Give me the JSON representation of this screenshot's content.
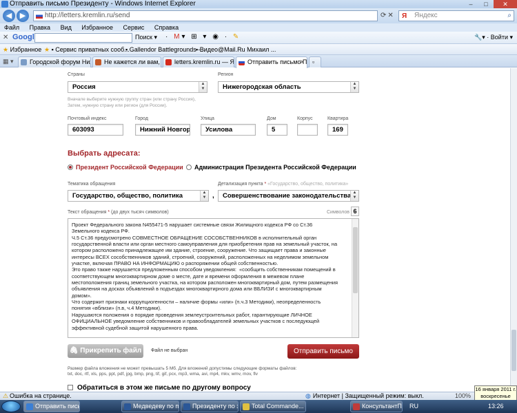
{
  "window": {
    "title": "Отправить письмо Президенту - Windows Internet Explorer",
    "url": "http://letters.kremlin.ru/send",
    "search_placeholder": "Яндекс"
  },
  "menu": [
    "Файл",
    "Правка",
    "Вид",
    "Избранное",
    "Сервис",
    "Справка"
  ],
  "google_toolbar": {
    "logo": "Google",
    "search_label": "Поиск",
    "signin_label": "Войти"
  },
  "favorites": {
    "label": "Избранное",
    "items": [
      "Сервис приватных сооб...",
      "Gallendor Battlegrounds -...",
      "Видео@Mail.Ru Михаил ..."
    ]
  },
  "tabs": [
    {
      "label": "Городской форум Нижне...",
      "active": false
    },
    {
      "label": "Не кажется ли вам, что м...",
      "active": false
    },
    {
      "label": "letters.kremlin.ru — Яндек...",
      "active": false
    },
    {
      "label": "Отправить письмо Пр...",
      "active": true
    }
  ],
  "form": {
    "country_label": "Страны",
    "country_value": "Россия",
    "region_label": "Регион",
    "region_value": "Нижегородская область",
    "country_hint": "Вначале выберите нужную группу стран (или страну Россия),\nЗатем, нужную страну или регион (для России).",
    "postcode_label": "Почтовый индекс",
    "postcode_value": "603093",
    "city_label": "Город",
    "city_value": "Нижний Новгор",
    "street_label": "Улица",
    "street_value": "Усилова",
    "house_label": "Дом",
    "house_value": "5",
    "building_label": "Корпус",
    "building_value": "",
    "flat_label": "Квартира",
    "flat_value": "169",
    "recipient_title": "Выбрать адресата:",
    "recipient_options": [
      {
        "label": "Президент Российской Федерации",
        "selected": true
      },
      {
        "label": "Администрация Президента Российской Федерации",
        "selected": false
      }
    ],
    "topic_label": "Тематика обращения",
    "topic_value": "Государство, общество, политика",
    "detail_label": "Детализация пункта",
    "detail_hint": "«Государство, общество, политика»",
    "detail_value": "Совершенствование законодательства",
    "text_label": "Текст обращения",
    "text_hint": "(до двух тысяч символов)",
    "symbols_label": "Символов",
    "symbols_count": "6",
    "message": "Проект Федерального закона N455471-5 нарушает системные связи Жилищного кодекса РФ со Ст.36\nЗемельного кодекса РФ.\nЧ.5 Ст.36 предусмотрено СОВМЕСТНОЕ ОБРАЩЕНИЕ СОСОБСТВЕННИКОВ в исполнительный орган\nгосударственной власти или орган местного самоуправления для приобретения прав на земельный участок, на\nкотором расположено принадлежащее им здание, строение, сооружение. Что защищает права и законные\nинтересы ВСЕХ сособственников зданий, строений, сооружений, расположенных на неделимом земельном\nучастке, включая ПРАВО НА ИНФОРМАЦИЮ о распоряжении общей собственностью.\nЭто право также нарушается предложенным способом уведомления:  «сообщить собственникам помещений в\nсоответствующем многоквартирном доме о месте, дате и времени оформления в межевом плане\nместоположения границ земельного участка, на котором расположен многоквартирный дом, путем размещения\nобъявления на досках объявлений в подъездах многоквартирного дома или ВБЛИЗИ с многоквартирным\nдомом».\nЧто содержит признаки коррупциогенности – наличие формы «или» (п.ч.3 Методики), неопределенность\nпонятия «вблизи» (п.в, ч.4 Методики).\nНарушаются положения о порядке проведения землеустроительных работ, гарантирующие ЛИЧНОЕ\nОФИЦИАЛЬНОЕ уведомление собственников и правообладателей земельных участков с последующей\nэффективной судебной защитой нарушенного права.",
    "attach_label": "Прикрепить файл",
    "no_file_label": "Файл не выбран",
    "send_label": "Отправить письмо",
    "size_info": "Размер файла вложения не может превышать 5 Мб. Для вложений допустимы следующие форматы файлов:",
    "formats_info": "txt, doc, rtf, xls, pps, ppt, pdf, jpg, bmp, png, tif, gif, pcx, mp3, wma, avi, mp4, mkv, wmv, mov, flv",
    "other_question_label": "Обратиться в этом же письме по другому вопросу"
  },
  "statusbar": {
    "error_text": "Ошибка на странице.",
    "zone_text": "Интернет | Защищенный режим: выкл.",
    "zoom_text": "100%"
  },
  "taskbar": {
    "tasks": [
      "Отправить письм...",
      "Медведеву по пр...",
      "Президенту по з...",
      "Total Commande...",
      "КонсультантПл..."
    ],
    "lang": "RU",
    "time": "13:26"
  },
  "tooltip": {
    "date": "16 января 2011 г.",
    "weekday": "воскресенье"
  }
}
